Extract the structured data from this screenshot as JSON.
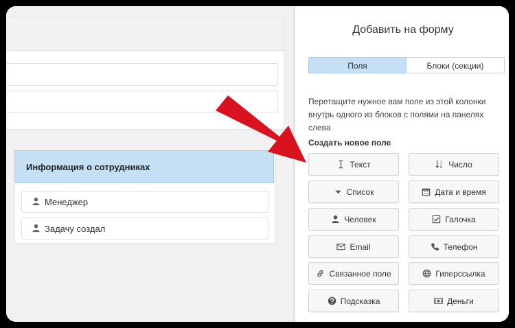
{
  "left": {
    "employees_card": {
      "title": "Информация о сотрудниках",
      "rows": [
        {
          "label": "Менеджер",
          "icon": "user-icon"
        },
        {
          "label": "Задачу создал",
          "icon": "user-icon"
        }
      ]
    }
  },
  "panel": {
    "title": "Добавить на форму",
    "tabs": [
      {
        "label": "Поля",
        "active": true
      },
      {
        "label": "Блоки (секции)",
        "active": false
      }
    ],
    "help": "Перетащите нужное вам поле из этой колонки внутрь одного из блоков с полями на панелях слева",
    "section_title": "Создать новое поле",
    "fields": [
      {
        "label": "Текст",
        "icon": "text-cursor-icon"
      },
      {
        "label": "Число",
        "icon": "number-sort-icon"
      },
      {
        "label": "Список",
        "icon": "caret-down-icon"
      },
      {
        "label": "Дата и время",
        "icon": "calendar-icon"
      },
      {
        "label": "Человек",
        "icon": "user-icon"
      },
      {
        "label": "Галочка",
        "icon": "checkbox-icon"
      },
      {
        "label": "Email",
        "icon": "envelope-icon"
      },
      {
        "label": "Телефон",
        "icon": "phone-icon"
      },
      {
        "label": "Связанное поле",
        "icon": "link-icon"
      },
      {
        "label": "Гиперссылка",
        "icon": "globe-icon"
      },
      {
        "label": "Подсказка",
        "icon": "question-icon"
      },
      {
        "label": "Деньги",
        "icon": "money-icon"
      }
    ]
  },
  "colors": {
    "accent_blue": "#c5dff4",
    "arrow_red": "#d8121f"
  }
}
